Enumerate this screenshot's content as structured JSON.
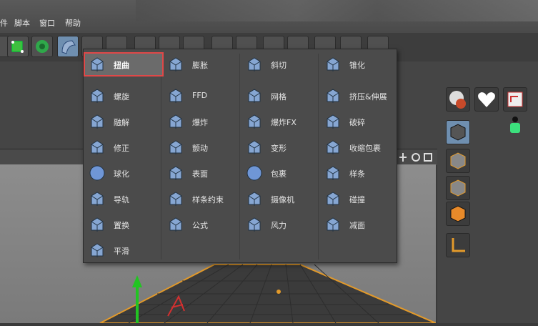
{
  "menubar": {
    "items": [
      "件",
      "脚本",
      "窗口",
      "帮助"
    ]
  },
  "deformer_menu": {
    "columns": [
      [
        {
          "label": "扭曲",
          "icon": "bend-icon",
          "selected": true
        },
        {
          "label": "螺旋",
          "icon": "twist-icon"
        },
        {
          "label": "融解",
          "icon": "melt-icon"
        },
        {
          "label": "修正",
          "icon": "correction-icon"
        },
        {
          "label": "球化",
          "icon": "spherify-icon"
        },
        {
          "label": "导轨",
          "icon": "rail-icon"
        },
        {
          "label": "置换",
          "icon": "displacer-icon"
        },
        {
          "label": "平滑",
          "icon": "smoothing-icon"
        }
      ],
      [
        {
          "label": "膨胀",
          "icon": "bulge-icon"
        },
        {
          "label": "FFD",
          "icon": "ffd-icon"
        },
        {
          "label": "爆炸",
          "icon": "explosion-icon"
        },
        {
          "label": "颤动",
          "icon": "jiggle-icon"
        },
        {
          "label": "表面",
          "icon": "surface-icon"
        },
        {
          "label": "样条约束",
          "icon": "spline-wrap-icon"
        },
        {
          "label": "公式",
          "icon": "formula-icon"
        }
      ],
      [
        {
          "label": "斜切",
          "icon": "shear-icon"
        },
        {
          "label": "网格",
          "icon": "mesh-icon"
        },
        {
          "label": "爆炸FX",
          "icon": "explosion-fx-icon"
        },
        {
          "label": "变形",
          "icon": "morph-icon"
        },
        {
          "label": "包裹",
          "icon": "wrap-icon"
        },
        {
          "label": "摄像机",
          "icon": "camera-icon"
        },
        {
          "label": "风力",
          "icon": "wind-icon"
        }
      ],
      [
        {
          "label": "锥化",
          "icon": "taper-icon"
        },
        {
          "label": "挤压&伸展",
          "icon": "squash-stretch-icon"
        },
        {
          "label": "破碎",
          "icon": "shatter-icon"
        },
        {
          "label": "收缩包裹",
          "icon": "shrink-wrap-icon"
        },
        {
          "label": "样条",
          "icon": "spline-deformer-icon"
        },
        {
          "label": "碰撞",
          "icon": "collision-icon"
        },
        {
          "label": "减面",
          "icon": "polygon-reduction-icon"
        }
      ]
    ]
  },
  "colors": {
    "accent_blue": "#6f8fb0",
    "highlight_border": "#e04848",
    "menu_bg": "#4b4b4b",
    "axis_green": "#22c422",
    "axis_red": "#d23030",
    "grid_orange": "#e39a2a"
  }
}
